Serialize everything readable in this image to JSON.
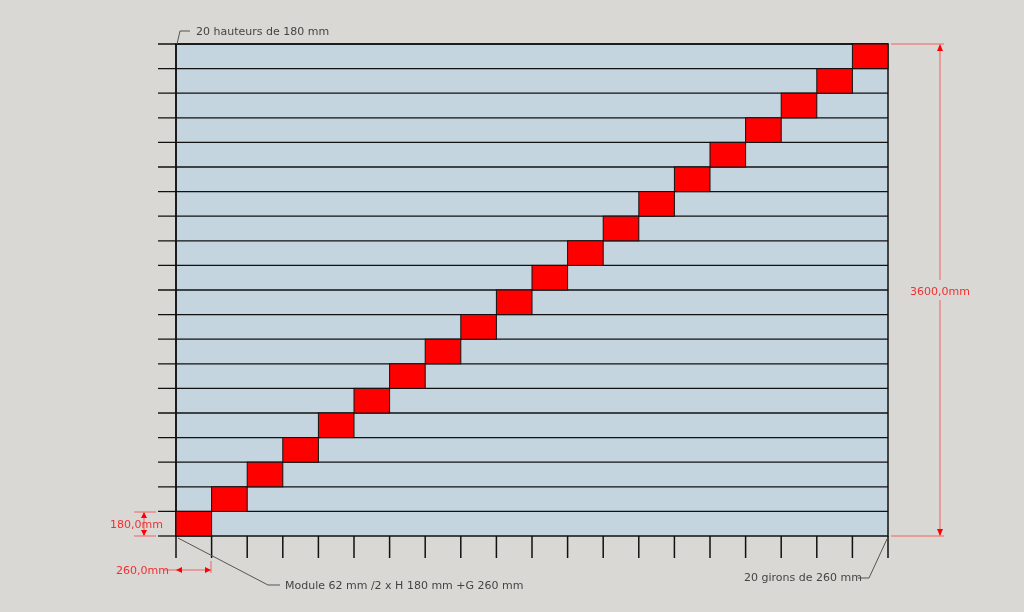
{
  "heights_note": "20 hauteurs de 180 mm",
  "height_dimension": "180,0mm",
  "tread_dimension": "260,0mm",
  "module_note": "Module 62 mm /2 x H 180 mm +G 260 mm",
  "treads_note": "20 girons de 260 mm",
  "total_height_dimension": "3600,0mm"
}
